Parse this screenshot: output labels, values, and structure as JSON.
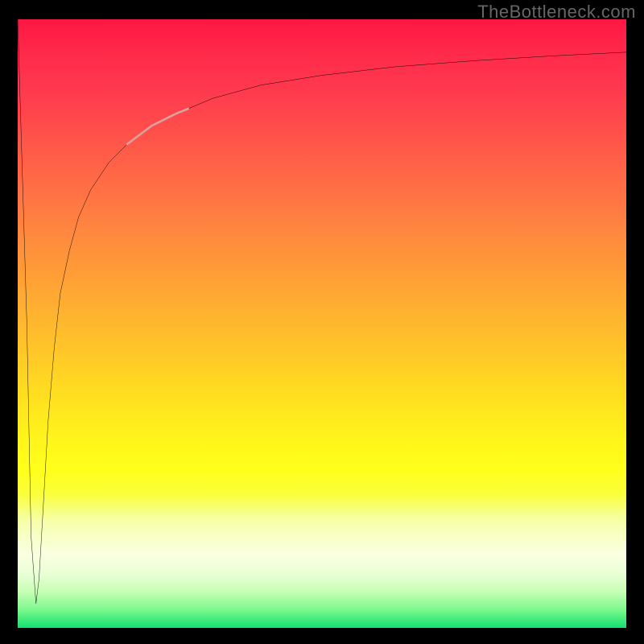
{
  "watermark": "TheBottleneck.com",
  "chart_data": {
    "type": "line",
    "title": "",
    "xlabel": "",
    "ylabel": "",
    "xlim": [
      0,
      100
    ],
    "ylim": [
      0,
      100
    ],
    "series": [
      {
        "name": "bottleneck-curve",
        "x": [
          0,
          1.5,
          2.2,
          3.0,
          3.5,
          4.2,
          5.0,
          6.0,
          7.0,
          8.5,
          10.0,
          12.0,
          15.0,
          18.0,
          22.0,
          26.0,
          28.0,
          32.0,
          40.0,
          50.0,
          62.0,
          75.0,
          88.0,
          100.0
        ],
        "y": [
          100,
          50,
          15,
          4,
          8,
          20,
          34,
          46,
          55,
          62,
          67.5,
          72,
          76.5,
          79.5,
          82.5,
          84.5,
          85.3,
          87.0,
          89.2,
          90.8,
          92.2,
          93.2,
          94.0,
          94.6
        ]
      },
      {
        "name": "highlight-segment",
        "x": [
          18.0,
          22.0,
          26.0,
          28.0
        ],
        "y": [
          79.5,
          82.5,
          84.5,
          85.3
        ]
      }
    ],
    "legend": false,
    "grid": false
  },
  "colors": {
    "curve": "#000000",
    "highlight": "#daa1a0",
    "gradient_top": "#ff1744",
    "gradient_bottom": "#12e070",
    "background": "#000000",
    "watermark": "#666666"
  }
}
